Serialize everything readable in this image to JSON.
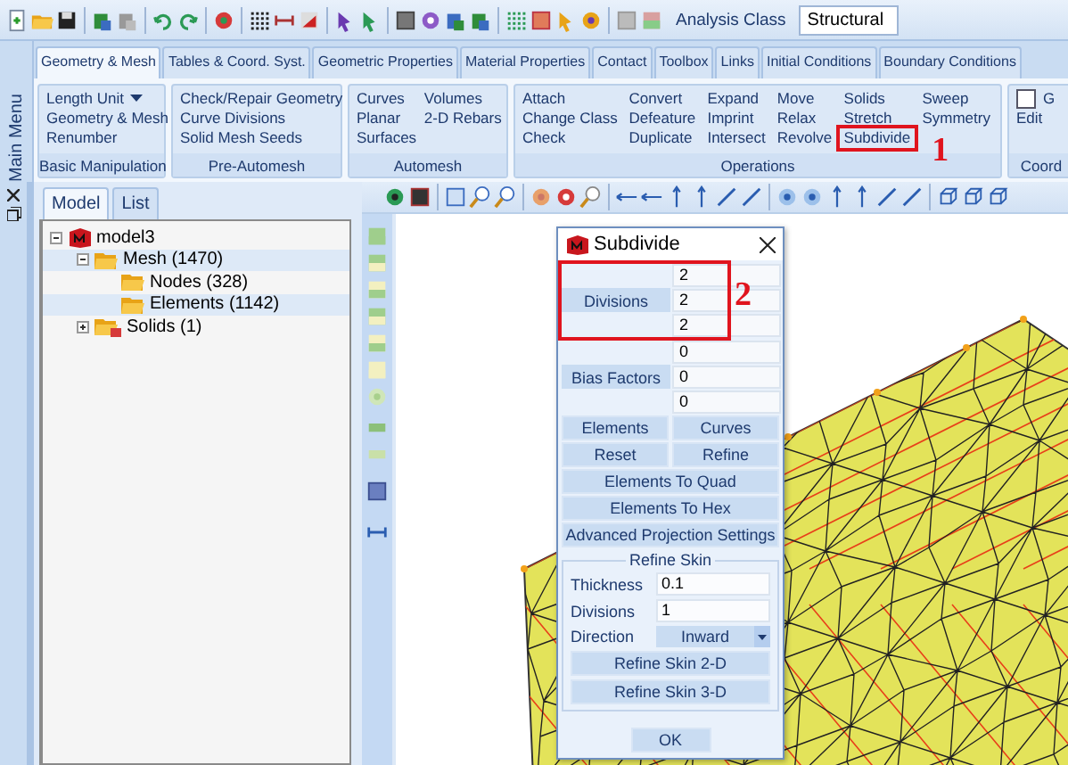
{
  "toolbar": {
    "analysis_class": {
      "label": "Analysis Class",
      "value": "Structural"
    }
  },
  "side_menu": {
    "title": "Main Menu"
  },
  "ribbon": {
    "tabs": [
      {
        "label": "Geometry & Mesh",
        "selected": true
      },
      {
        "label": "Tables & Coord. Syst.",
        "selected": false
      },
      {
        "label": "Geometric Properties",
        "selected": false
      },
      {
        "label": "Material Properties",
        "selected": false
      },
      {
        "label": "Contact",
        "selected": false
      },
      {
        "label": "Toolbox",
        "selected": false
      },
      {
        "label": "Links",
        "selected": false
      },
      {
        "label": "Initial Conditions",
        "selected": false
      },
      {
        "label": "Boundary Conditions",
        "selected": false
      }
    ],
    "groups": [
      {
        "title": "Basic Manipulation",
        "columns": [
          [
            {
              "label": "Length Unit",
              "kind": "dropdown",
              "highlighted": false
            },
            {
              "label": "Geometry & Mesh",
              "kind": "command",
              "highlighted": false
            },
            {
              "label": "Renumber",
              "kind": "command",
              "highlighted": false
            }
          ]
        ]
      },
      {
        "title": "Pre-Automesh",
        "columns": [
          [
            {
              "label": "Check/Repair Geometry",
              "kind": "command",
              "highlighted": false
            },
            {
              "label": "Curve Divisions",
              "kind": "command",
              "highlighted": false
            },
            {
              "label": "Solid Mesh Seeds",
              "kind": "command",
              "highlighted": false
            }
          ]
        ]
      },
      {
        "title": "Automesh",
        "columns": [
          [
            {
              "label": "Curves",
              "kind": "command",
              "highlighted": false
            },
            {
              "label": "Planar",
              "kind": "command",
              "highlighted": false
            },
            {
              "label": "Surfaces",
              "kind": "command",
              "highlighted": false
            }
          ],
          [
            {
              "label": "Volumes",
              "kind": "command",
              "highlighted": false
            },
            {
              "label": "2-D Rebars",
              "kind": "command",
              "highlighted": false
            }
          ]
        ]
      },
      {
        "title": "Operations",
        "columns": [
          [
            {
              "label": "Attach",
              "kind": "command",
              "highlighted": false
            },
            {
              "label": "Change Class",
              "kind": "command",
              "highlighted": false
            },
            {
              "label": "Check",
              "kind": "command",
              "highlighted": false
            }
          ],
          [
            {
              "label": "Convert",
              "kind": "command",
              "highlighted": false
            },
            {
              "label": "Defeature",
              "kind": "command",
              "highlighted": false
            },
            {
              "label": "Duplicate",
              "kind": "command",
              "highlighted": false
            }
          ],
          [
            {
              "label": "Expand",
              "kind": "command",
              "highlighted": false
            },
            {
              "label": "Imprint",
              "kind": "command",
              "highlighted": false
            },
            {
              "label": "Intersect",
              "kind": "command",
              "highlighted": false
            }
          ],
          [
            {
              "label": "Move",
              "kind": "command",
              "highlighted": false
            },
            {
              "label": "Relax",
              "kind": "command",
              "highlighted": false
            },
            {
              "label": "Revolve",
              "kind": "command",
              "highlighted": false
            }
          ],
          [
            {
              "label": "Solids",
              "kind": "command",
              "highlighted": false
            },
            {
              "label": "Stretch",
              "kind": "command",
              "highlighted": false
            },
            {
              "label": "Subdivide",
              "kind": "command",
              "highlighted": true,
              "annotation": "1"
            }
          ],
          [
            {
              "label": "Sweep",
              "kind": "command",
              "highlighted": false
            },
            {
              "label": "Symmetry",
              "kind": "command",
              "highlighted": false
            }
          ]
        ]
      },
      {
        "title": "Coord",
        "columns": [
          [
            {
              "label": "G",
              "kind": "checkbox",
              "checked": false,
              "highlighted": false
            },
            {
              "label": "Edit",
              "kind": "command",
              "highlighted": false
            }
          ]
        ]
      }
    ]
  },
  "model_panel": {
    "tabs": [
      {
        "label": "Model",
        "selected": true
      },
      {
        "label": "List",
        "selected": false
      }
    ],
    "tree": [
      {
        "label": "model3",
        "kind": "model",
        "expanded": true,
        "highlighted": false,
        "children": [
          {
            "label": "Mesh (1470)",
            "kind": "folder",
            "expanded": true,
            "highlighted": true,
            "children": [
              {
                "label": "Nodes (328)",
                "kind": "folder",
                "highlighted": false
              },
              {
                "label": "Elements (1142)",
                "kind": "folder",
                "highlighted": true
              }
            ]
          },
          {
            "label": "Solids (1)",
            "kind": "solids",
            "expanded": false,
            "highlighted": false
          }
        ]
      }
    ]
  },
  "dialog": {
    "title": "Subdivide",
    "vector_groups": [
      {
        "label": "Divisions",
        "values": [
          "2",
          "2",
          "2"
        ],
        "highlighted": true,
        "annotation": "2"
      },
      {
        "label": "Bias Factors",
        "values": [
          "0",
          "0",
          "0"
        ],
        "highlighted": false
      }
    ],
    "button_pairs": [
      [
        "Elements",
        "Curves"
      ],
      [
        "Reset",
        "Refine"
      ]
    ],
    "wide_buttons": [
      "Elements To Quad",
      "Elements To Hex",
      "Advanced Projection Settings"
    ],
    "refine_skin": {
      "title": "Refine Skin",
      "fields": [
        {
          "label": "Thickness",
          "value": "0.1",
          "kind": "input"
        },
        {
          "label": "Divisions",
          "value": "1",
          "kind": "input"
        },
        {
          "label": "Direction",
          "value": "Inward",
          "kind": "select"
        }
      ],
      "buttons": [
        "Refine Skin 2-D",
        "Refine Skin 3-D"
      ]
    },
    "ok": "OK"
  }
}
